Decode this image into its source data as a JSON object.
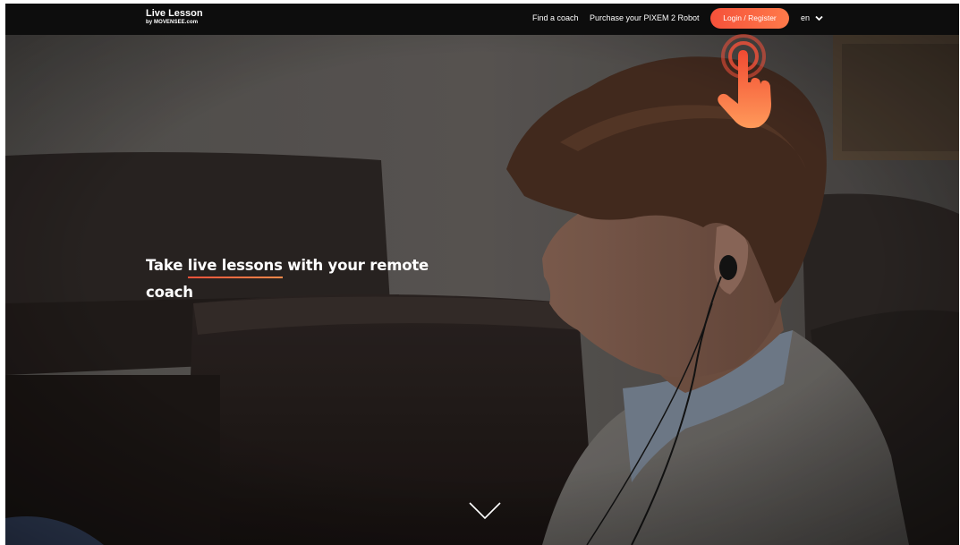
{
  "nav": {
    "logo_title": "Live Lesson",
    "logo_sub": "by MOVENSEE.com",
    "find_coach": "Find a coach",
    "purchase": "Purchase your PIXEM 2 Robot",
    "login": "Login / Register",
    "language": "en"
  },
  "hero": {
    "headline_before": "Take ",
    "headline_highlight": "live lessons",
    "headline_after": " with your remote coach",
    "scroll_icon": "chevron-down-icon"
  },
  "overlay": {
    "tap_icon": "hand-tap-icon"
  },
  "colors": {
    "accent": "#f5513a",
    "accent_light": "#ff8a4a",
    "navbar": "#0d0d0d"
  }
}
